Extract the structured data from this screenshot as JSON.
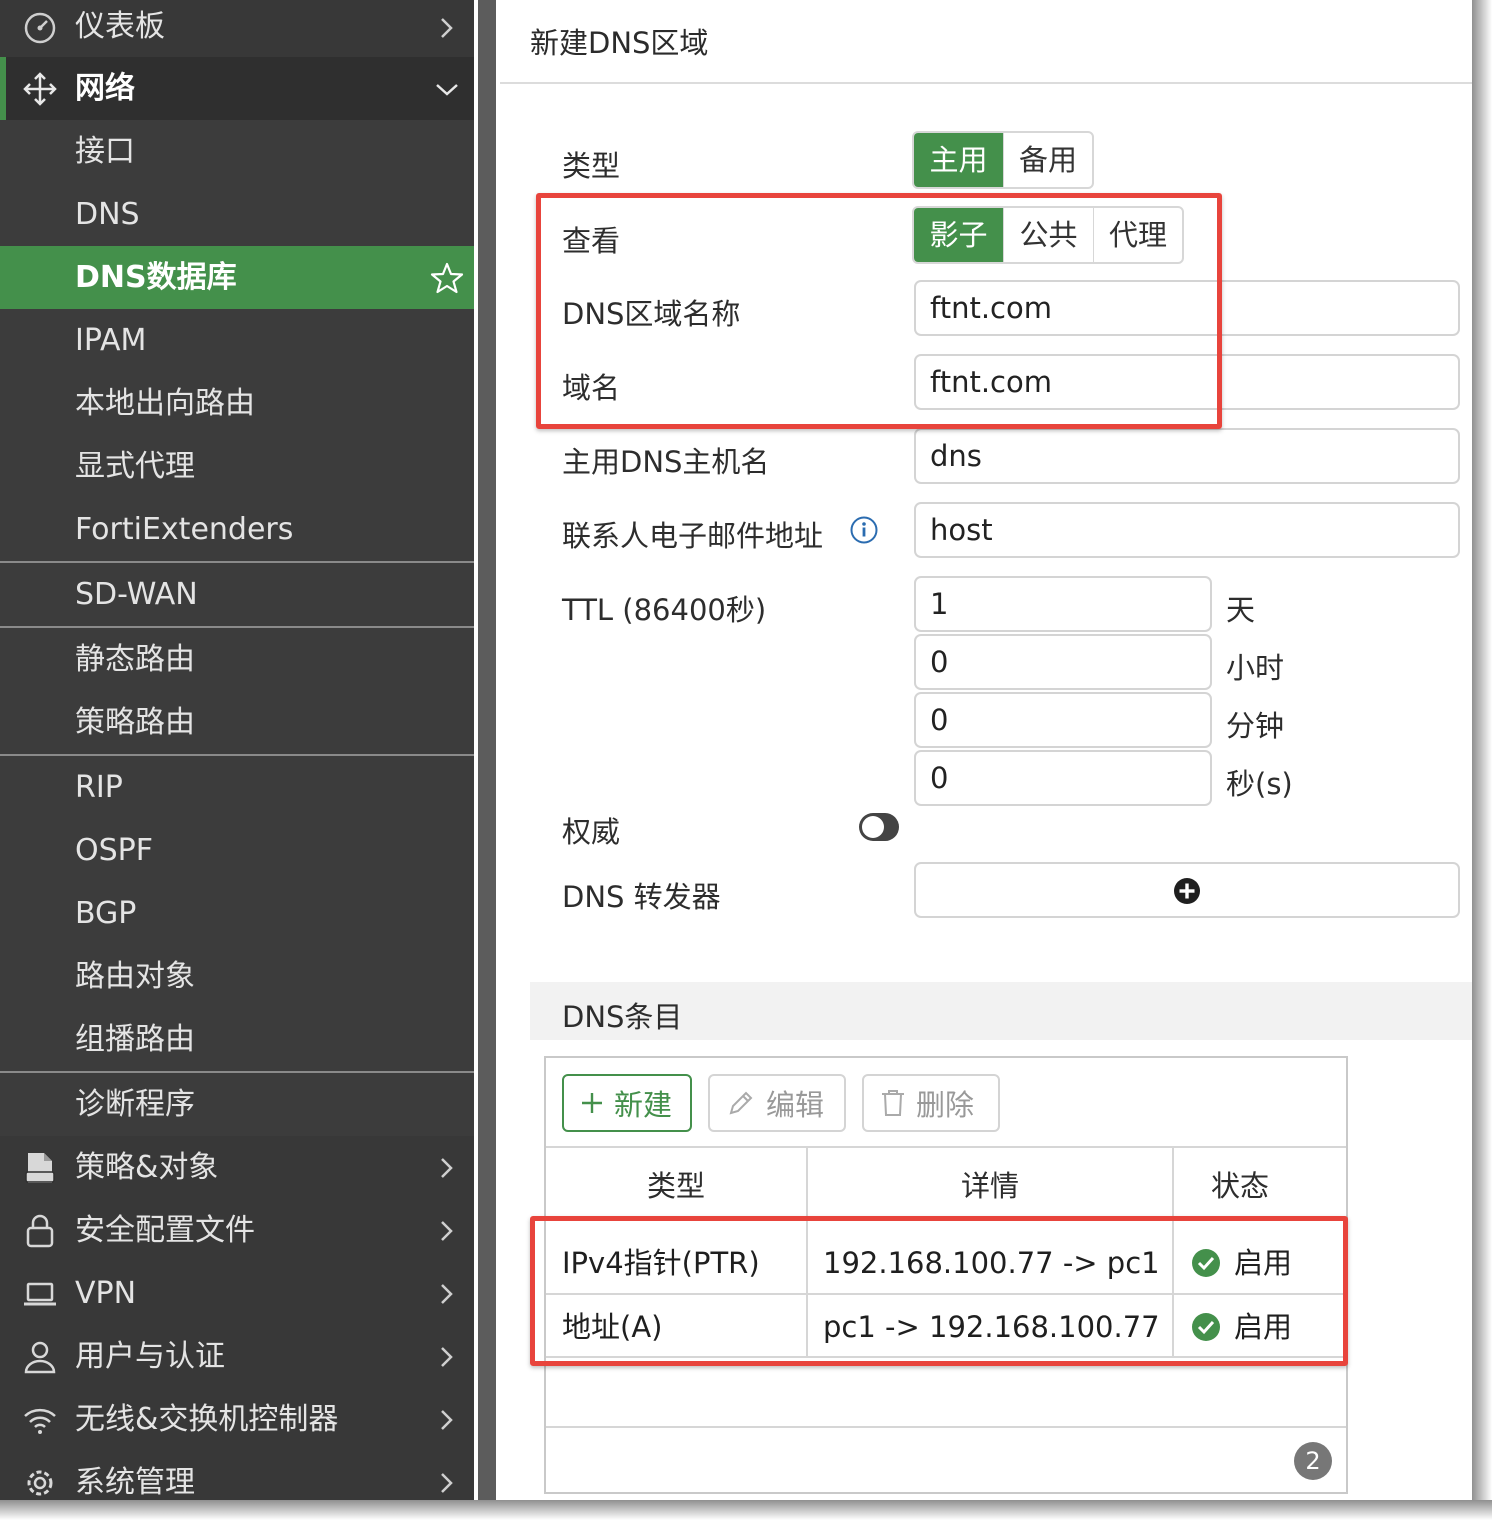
{
  "sidebar": {
    "items": [
      {
        "label": "仪表板",
        "icon": "dashboard-icon"
      },
      {
        "label": "网络",
        "icon": "move-arrows-icon"
      },
      {
        "label": "接口"
      },
      {
        "label": "DNS"
      },
      {
        "label": "DNS数据库"
      },
      {
        "label": "IPAM"
      },
      {
        "label": "本地出向路由"
      },
      {
        "label": "显式代理"
      },
      {
        "label": "FortiExtenders"
      },
      {
        "label": "SD-WAN"
      },
      {
        "label": "静态路由"
      },
      {
        "label": "策略路由"
      },
      {
        "label": "RIP"
      },
      {
        "label": "OSPF"
      },
      {
        "label": "BGP"
      },
      {
        "label": "路由对象"
      },
      {
        "label": "组播路由"
      },
      {
        "label": "诊断程序"
      },
      {
        "label": "策略&对象",
        "icon": "policy-document-icon"
      },
      {
        "label": "安全配置文件",
        "icon": "lock-icon"
      },
      {
        "label": "VPN",
        "icon": "laptop-icon"
      },
      {
        "label": "用户与认证",
        "icon": "user-icon"
      },
      {
        "label": "无线&交换机控制器",
        "icon": "wifi-icon"
      },
      {
        "label": "系统管理",
        "icon": "gear-icon"
      }
    ],
    "active_item": "DNS数据库"
  },
  "panel": {
    "title": "新建DNS区域"
  },
  "form": {
    "type_label": "类型",
    "type_options": [
      "主用",
      "备用"
    ],
    "type_selected": "主用",
    "view_label": "查看",
    "view_options": [
      "影子",
      "公共",
      "代理"
    ],
    "view_selected": "影子",
    "zone_name_label": "DNS区域名称",
    "zone_name_value": "ftnt.com",
    "domain_label": "域名",
    "domain_value": "ftnt.com",
    "primary_host_label": "主用DNS主机名",
    "primary_host_value": "dns",
    "contact_email_label": "联系人电子邮件地址",
    "contact_email_value": "host",
    "ttl_label": "TTL (86400秒)",
    "ttl_days": "1",
    "ttl_days_unit": "天",
    "ttl_hours": "0",
    "ttl_hours_unit": "小时",
    "ttl_minutes": "0",
    "ttl_minutes_unit": "分钟",
    "ttl_seconds": "0",
    "ttl_seconds_unit": "秒(s)",
    "authoritative_label": "权威",
    "authoritative_on": false,
    "forwarder_label": "DNS 转发器"
  },
  "entries": {
    "section_title": "DNS条目",
    "toolbar": {
      "new_label": "新建",
      "edit_label": "编辑",
      "delete_label": "删除"
    },
    "columns": [
      "类型",
      "详情",
      "状态"
    ],
    "rows": [
      {
        "type": "IPv4指针(PTR)",
        "detail": "192.168.100.77 -> pc1",
        "status": "启用"
      },
      {
        "type": "地址(A)",
        "detail": "pc1 -> 192.168.100.77",
        "status": "启用"
      }
    ],
    "count": "2"
  },
  "colors": {
    "accent_green": "#44904b",
    "highlight_red": "#e8443c",
    "sidebar_bg": "#2f2f2f"
  }
}
